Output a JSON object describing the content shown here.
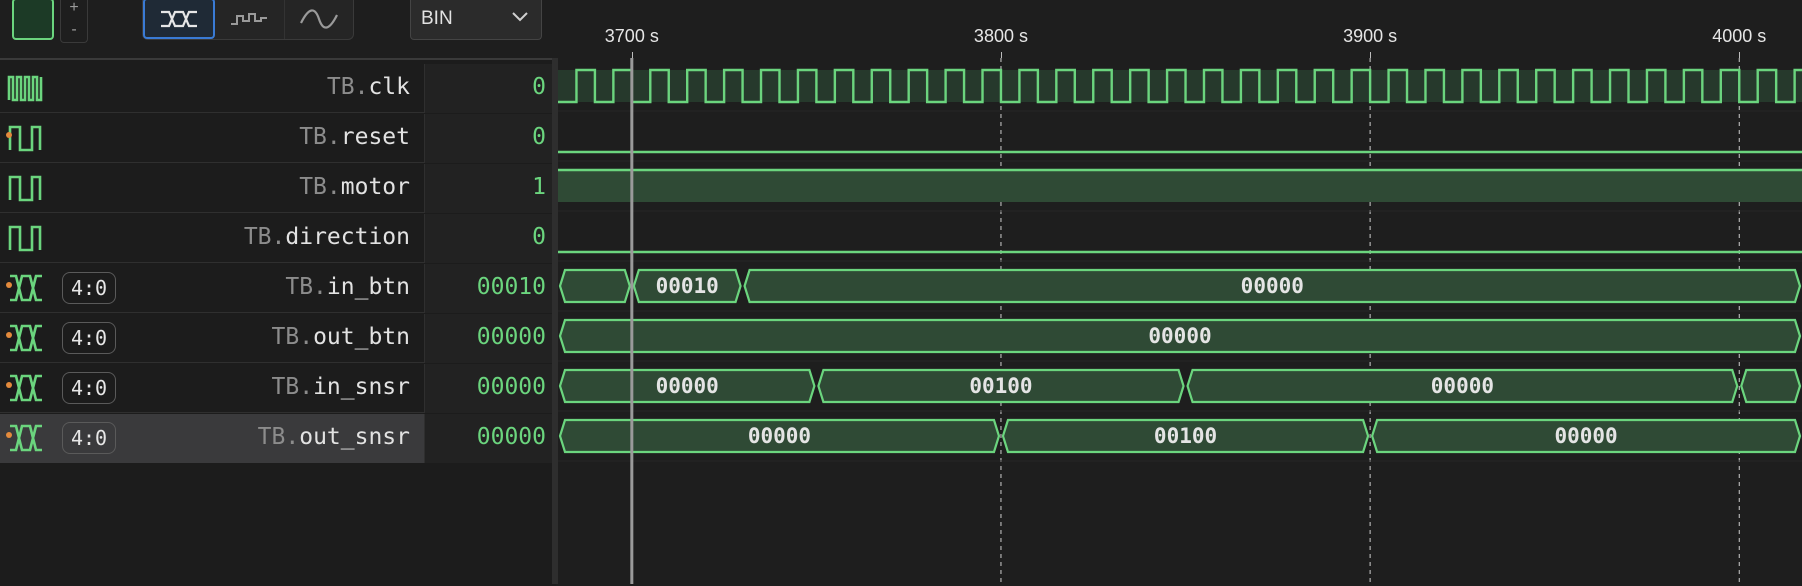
{
  "toolbar": {
    "zoom_in_label": "+",
    "zoom_out_label": "-",
    "wave_styles": [
      {
        "name": "bus-style",
        "icon": "bus-wave-icon",
        "active": true
      },
      {
        "name": "step-style",
        "icon": "step-wave-icon",
        "active": false
      },
      {
        "name": "analog-style",
        "icon": "analog-wave-icon",
        "active": false
      }
    ],
    "radix": "BIN",
    "signal_color": "#6bd57e"
  },
  "ruler": {
    "ticks": [
      {
        "label": "3700 s",
        "t": 3700
      },
      {
        "label": "3800 s",
        "t": 3800
      },
      {
        "label": "3900 s",
        "t": 3900
      },
      {
        "label": "4000 s",
        "t": 4000
      }
    ],
    "cursor_time": 3700
  },
  "signals": [
    {
      "scope": "TB.",
      "name": "clk",
      "value": "0",
      "kind": "clock",
      "dot": false,
      "width": ""
    },
    {
      "scope": "TB.",
      "name": "reset",
      "value": "0",
      "kind": "bit",
      "dot": true,
      "width": ""
    },
    {
      "scope": "TB.",
      "name": "motor",
      "value": "1",
      "kind": "bit",
      "dot": false,
      "width": ""
    },
    {
      "scope": "TB.",
      "name": "direction",
      "value": "0",
      "kind": "bit",
      "dot": false,
      "width": ""
    },
    {
      "scope": "TB.",
      "name": "in_btn",
      "value": "00010",
      "kind": "bus",
      "dot": true,
      "width": "4:0"
    },
    {
      "scope": "TB.",
      "name": "out_btn",
      "value": "00000",
      "kind": "bus",
      "dot": true,
      "width": "4:0"
    },
    {
      "scope": "TB.",
      "name": "in_snsr",
      "value": "00000",
      "kind": "bus",
      "dot": true,
      "width": "4:0"
    },
    {
      "scope": "TB.",
      "name": "out_snsr",
      "value": "00000",
      "kind": "bus",
      "dot": true,
      "width": "4:0",
      "selected": true
    }
  ],
  "waveforms": {
    "view_start": 3680,
    "view_end": 4017,
    "clock_period": 10,
    "bits": {
      "reset": 0,
      "motor": 1,
      "direction": 0
    },
    "buses": {
      "in_btn": [
        {
          "from": 3680,
          "to": 3700,
          "label": ""
        },
        {
          "from": 3700,
          "to": 3730,
          "label": "00010"
        },
        {
          "from": 3730,
          "to": 4017,
          "label": "00000"
        }
      ],
      "out_btn": [
        {
          "from": 3680,
          "to": 4017,
          "label": "00000"
        }
      ],
      "in_snsr": [
        {
          "from": 3680,
          "to": 3750,
          "label": "00000"
        },
        {
          "from": 3750,
          "to": 3850,
          "label": "00100"
        },
        {
          "from": 3850,
          "to": 4000,
          "label": "00000"
        },
        {
          "from": 4000,
          "to": 4017,
          "label": ""
        }
      ],
      "out_snsr": [
        {
          "from": 3680,
          "to": 3800,
          "label": "00000"
        },
        {
          "from": 3800,
          "to": 3900,
          "label": "00100"
        },
        {
          "from": 3900,
          "to": 4017,
          "label": "00000"
        }
      ]
    }
  }
}
